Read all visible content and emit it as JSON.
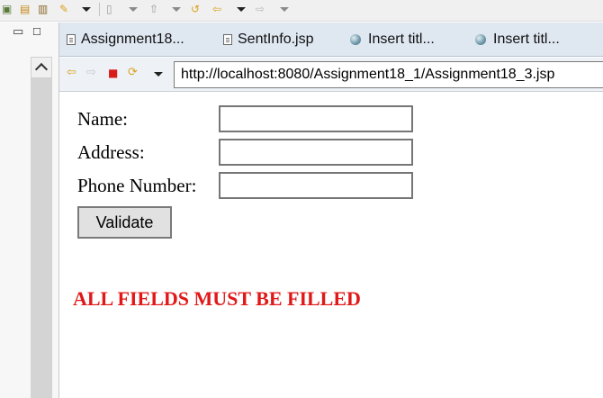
{
  "tabs": [
    {
      "label": "Assignment18...",
      "icon": "jsp-file-icon"
    },
    {
      "label": "SentInfo.jsp",
      "icon": "jsp-file-icon"
    },
    {
      "label": "Insert titl...",
      "icon": "globe-icon"
    },
    {
      "label": "Insert titl...",
      "icon": "globe-icon"
    }
  ],
  "browser": {
    "url": "http://localhost:8080/Assignment18_1/Assignment18_3.jsp"
  },
  "form": {
    "name_label": "Name:",
    "address_label": "Address:",
    "phone_label": "Phone Number:",
    "name_value": "",
    "address_value": "",
    "phone_value": "",
    "validate_label": "Validate",
    "error_message": "ALL FIELDS MUST BE FILLED",
    "error_color": "#e01818"
  }
}
